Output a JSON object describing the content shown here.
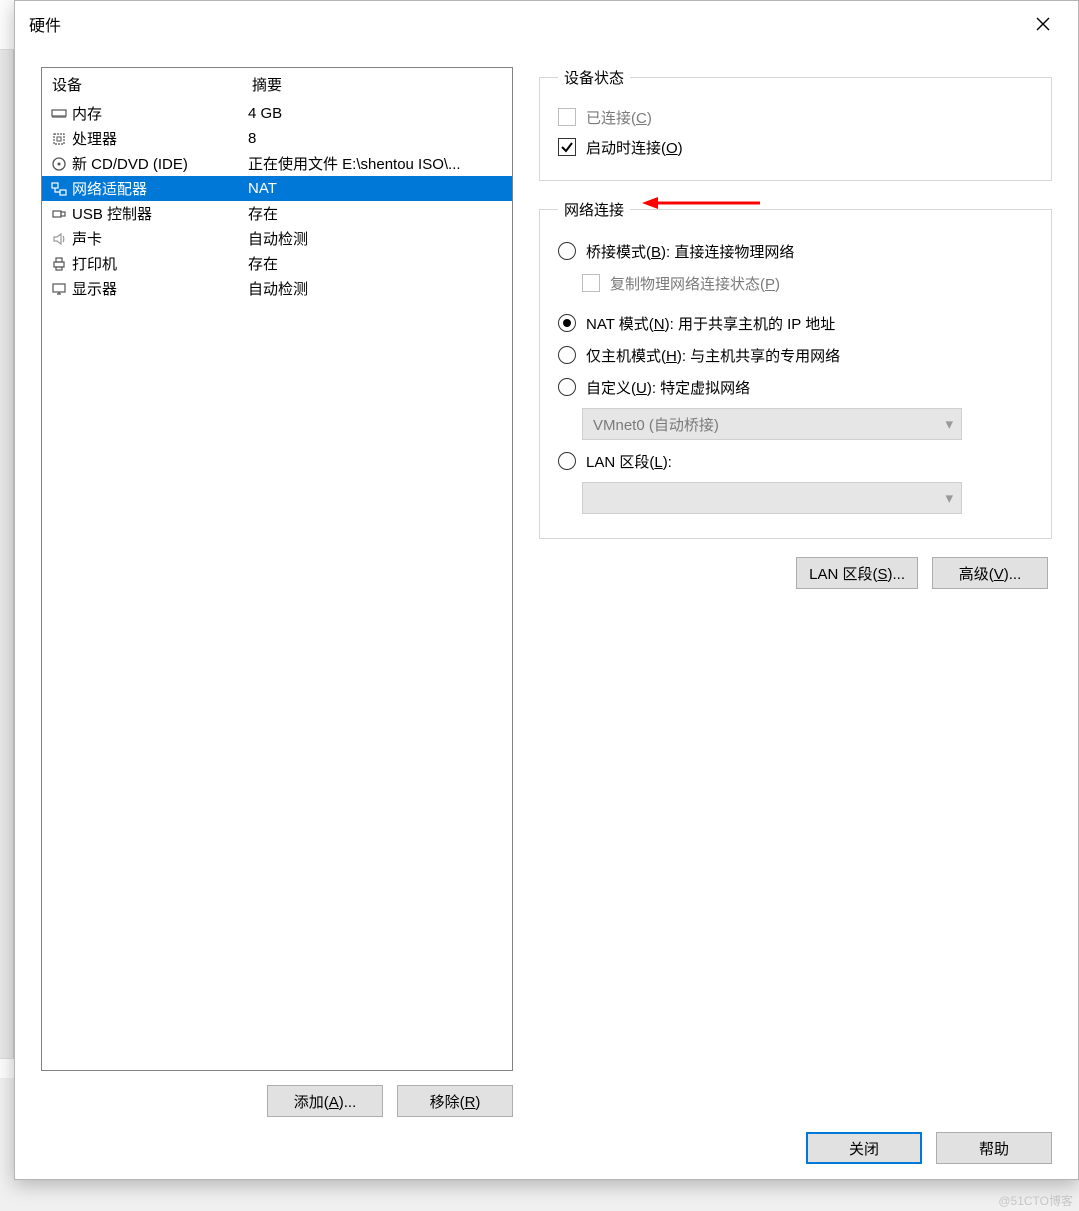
{
  "dialog": {
    "title": "硬件"
  },
  "deviceList": {
    "headers": {
      "device": "设备",
      "summary": "摘要"
    },
    "rows": [
      {
        "icon": "memory-icon",
        "name": "内存",
        "summary": "4 GB"
      },
      {
        "icon": "cpu-icon",
        "name": "处理器",
        "summary": "8"
      },
      {
        "icon": "disc-icon",
        "name": "新 CD/DVD (IDE)",
        "summary": "正在使用文件 E:\\shentou ISO\\..."
      },
      {
        "icon": "network-icon",
        "name": "网络适配器",
        "summary": "NAT"
      },
      {
        "icon": "usb-icon",
        "name": "USB 控制器",
        "summary": "存在"
      },
      {
        "icon": "sound-icon",
        "name": "声卡",
        "summary": "自动检测"
      },
      {
        "icon": "printer-icon",
        "name": "打印机",
        "summary": "存在"
      },
      {
        "icon": "display-icon",
        "name": "显示器",
        "summary": "自动检测"
      }
    ],
    "selectedIndex": 3
  },
  "deviceButtons": {
    "add": "添加(A)...",
    "remove": "移除(R)"
  },
  "deviceState": {
    "legend": "设备状态",
    "connected": {
      "label": "已连接(C)",
      "checked": false,
      "enabled": false
    },
    "connectBoot": {
      "label": "启动时连接(O)",
      "checked": true,
      "enabled": true
    }
  },
  "netConn": {
    "legend": "网络连接",
    "bridged": {
      "label": "桥接模式(B): 直接连接物理网络"
    },
    "replicate": {
      "label": "复制物理网络连接状态(P)"
    },
    "nat": {
      "label": "NAT 模式(N): 用于共享主机的 IP 地址"
    },
    "hostOnly": {
      "label": "仅主机模式(H): 与主机共享的专用网络"
    },
    "custom": {
      "label": "自定义(U): 特定虚拟网络"
    },
    "vmnetCombo": {
      "value": "VMnet0 (自动桥接)"
    },
    "lanSeg": {
      "label": "LAN 区段(L):"
    },
    "selected": "nat"
  },
  "rightButtons": {
    "lanSegments": "LAN 区段(S)...",
    "advanced": "高级(V)..."
  },
  "footer": {
    "close": "关闭",
    "help": "帮助"
  },
  "watermark": "@51CTO博客"
}
